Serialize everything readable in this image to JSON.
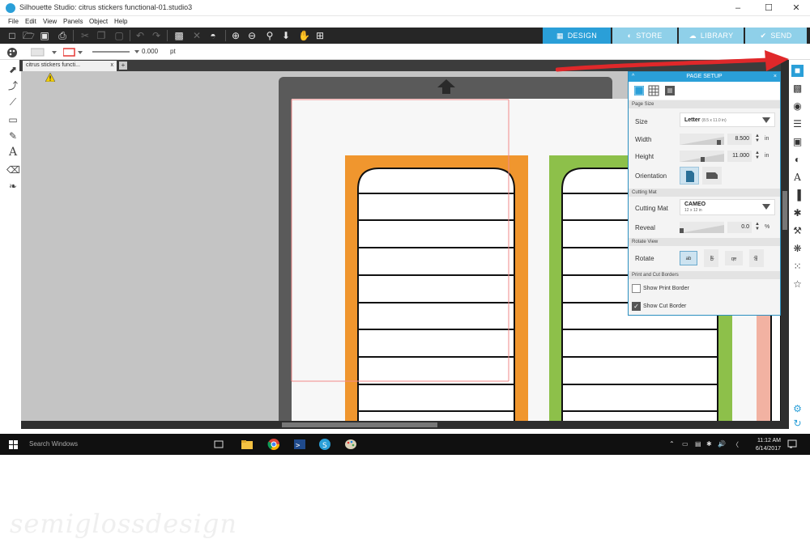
{
  "window": {
    "title": "Silhouette Studio: citrus stickers functional-01.studio3",
    "minimize": "–",
    "maximize": "☐",
    "close": "✕"
  },
  "menu": [
    "File",
    "Edit",
    "View",
    "Panels",
    "Object",
    "Help"
  ],
  "nav_tabs": [
    {
      "label": "DESIGN",
      "icon": "grid-icon",
      "active": true
    },
    {
      "label": "STORE",
      "icon": "store-icon",
      "active": false
    },
    {
      "label": "LIBRARY",
      "icon": "cloud-icon",
      "active": false
    },
    {
      "label": "SEND",
      "icon": "send-icon",
      "active": false
    }
  ],
  "property_bar": {
    "line_width": "0.000",
    "unit": "pt"
  },
  "document_tab": {
    "name": "citrus stickers functi...",
    "close": "x",
    "add": "+"
  },
  "page_setup": {
    "title": "PAGE SETUP",
    "sections": {
      "page_size": "Page Size",
      "cutting_mat": "Cutting Mat",
      "rotate_view": "Rotate View",
      "print_cut": "Print and Cut Borders"
    },
    "size": {
      "label": "Size",
      "value": "Letter",
      "detail": "(8.5 x 11.0 in)"
    },
    "width": {
      "label": "Width",
      "value": "8.500",
      "unit": "in"
    },
    "height": {
      "label": "Height",
      "value": "11.000",
      "unit": "in"
    },
    "orientation": {
      "label": "Orientation"
    },
    "mat": {
      "label": "Cutting Mat",
      "value": "CAMEO",
      "detail": "12 x 12 in"
    },
    "reveal": {
      "label": "Reveal",
      "value": "0.0",
      "unit": "%"
    },
    "rotate": {
      "label": "Rotate",
      "options": [
        "ab",
        "ab",
        "ab",
        "ab"
      ]
    },
    "show_print_border": {
      "label": "Show Print Border",
      "checked": false
    },
    "show_cut_border": {
      "label": "Show Cut Border",
      "checked": true
    }
  },
  "taskbar": {
    "search": "Search Windows",
    "time": "11:12 AM",
    "date": "6/14/2017"
  },
  "colors": {
    "accent": "#2a9fd8",
    "orange_label": "#f0962e",
    "green_label": "#8dc04a",
    "pink_label": "#f2b2a2",
    "arrow": "#e0282a"
  },
  "watermark": "semiglossdesign"
}
